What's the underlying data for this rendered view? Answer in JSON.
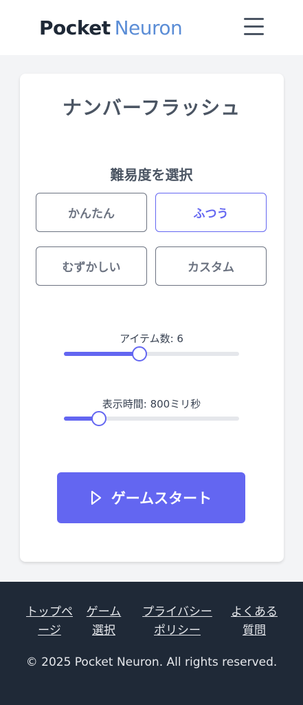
{
  "header": {
    "logo_part1": "Pocket",
    "logo_part2": "Neuron",
    "menu_icon": "hamburger-menu-icon"
  },
  "game": {
    "title": "ナンバーフラッシュ",
    "difficulty_heading": "難易度を選択",
    "difficulties": [
      {
        "label": "かんたん",
        "selected": false
      },
      {
        "label": "ふつう",
        "selected": true
      },
      {
        "label": "むずかしい",
        "selected": false
      },
      {
        "label": "カスタム",
        "selected": false
      }
    ],
    "items_slider": {
      "label": "アイテム数: 6",
      "level": 0.43
    },
    "time_slider": {
      "label": "表示時間: 800ミリ秒",
      "level": 0.2
    },
    "start_button": {
      "label": "ゲームスタート",
      "icon": "play-icon"
    }
  },
  "footer": {
    "links": [
      {
        "line1": "トップペ",
        "line2": "ージ"
      },
      {
        "line1": "ゲーム",
        "line2": "選択"
      },
      {
        "line1": "プライバシー",
        "line2": "ポリシー"
      },
      {
        "line1": "よくある",
        "line2": "質問"
      }
    ],
    "copyright": "© 2025 Pocket Neuron. All rights reserved."
  },
  "colors": {
    "accent": "#6366f1",
    "footer_bg": "#1f2937",
    "logo_accent": "#5b8dd6"
  }
}
